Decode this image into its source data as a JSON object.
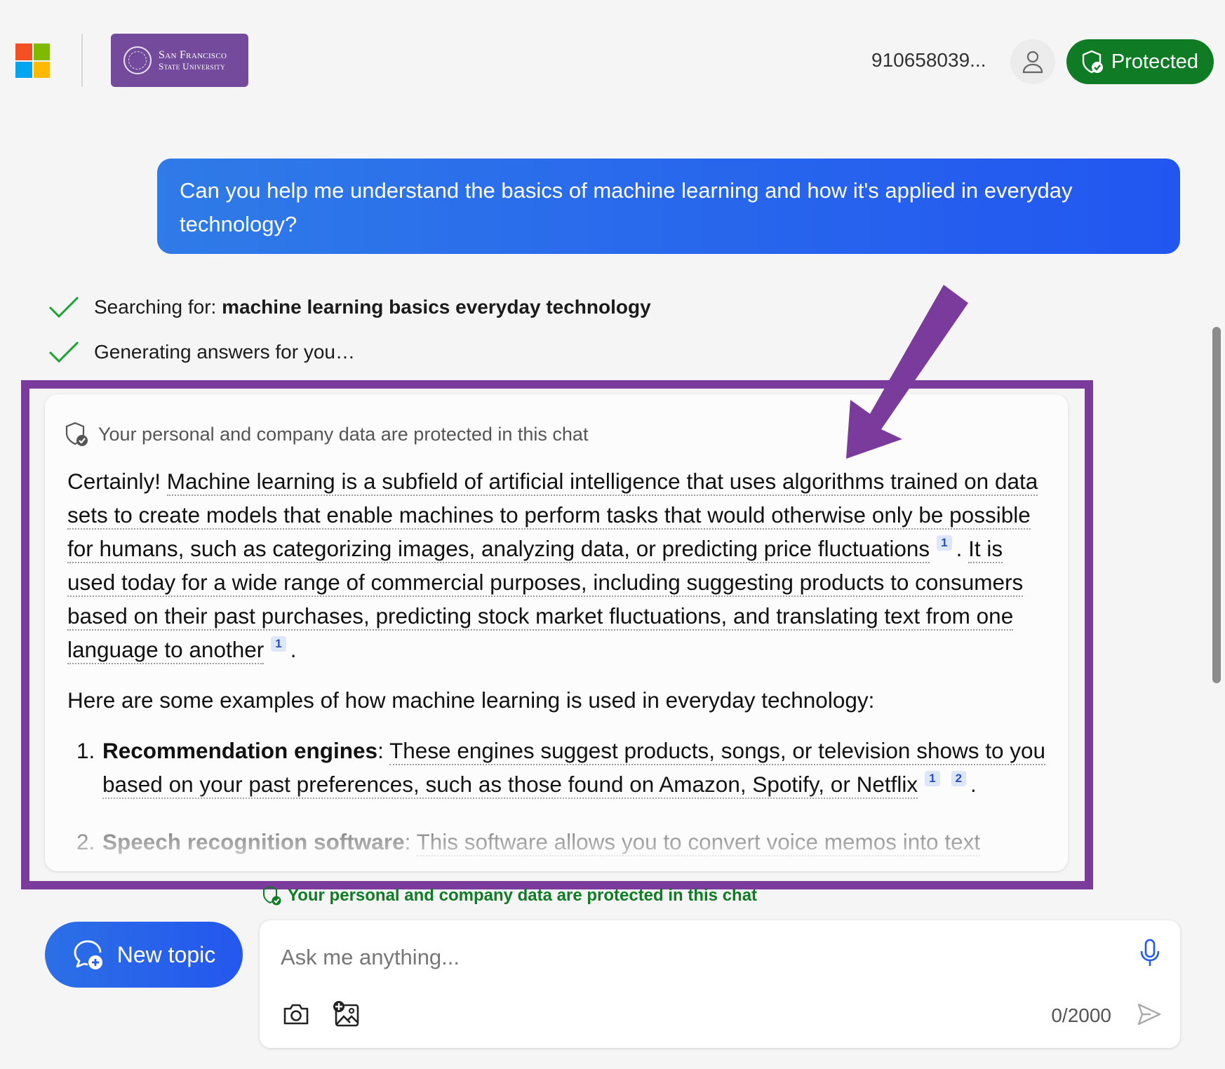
{
  "header": {
    "brand_colors": [
      "#f25022",
      "#7fba00",
      "#00a4ef",
      "#ffb900"
    ],
    "university_line1": "San Francisco",
    "university_line2": "State University",
    "user_id": "910658039...",
    "protected_label": "Protected",
    "protected_color": "#0f7b24"
  },
  "conversation": {
    "user_message": "Can you help me understand the basics of machine learning and how it's applied in everyday technology?",
    "status": [
      {
        "prefix": "Searching for: ",
        "query": "machine learning basics everyday technology"
      },
      {
        "prefix": "Generating answers for you…",
        "query": ""
      }
    ],
    "answer": {
      "privacy_note": "Your personal and company data are protected in this chat",
      "p1_lead": "Certainly! ",
      "p1_s1": "Machine learning is a subfield of artificial intelligence that uses algorithms trained on data sets to create models that enable machines to perform tasks that would otherwise only be possible for humans, such as categorizing images, analyzing data, or predicting price fluctuations",
      "p1_s1_cite": "1",
      "p1_s2": "It is used today for a wide range of commercial purposes, including suggesting products to consumers based on their past purchases, predicting stock market fluctuations, and translating text from one language to another",
      "p1_s2_cite": "1",
      "p2": "Here are some examples of how machine learning is used in everyday technology:",
      "examples": [
        {
          "title": "Recommendation engines",
          "text": "These engines suggest products, songs, or television shows to you based on your past preferences, such as those found on Amazon, Spotify, or Netflix",
          "cites": [
            "1",
            "2"
          ]
        },
        {
          "title": "Speech recognition software",
          "text": "This software allows you to convert voice memos into text",
          "cites": []
        }
      ]
    }
  },
  "footer": {
    "privacy_note": "Your personal and company data are protected in this chat",
    "new_topic_label": "New topic",
    "input_placeholder": "Ask me anything...",
    "char_counter": "0/2000"
  },
  "annotation_color": "#7a3b9c"
}
